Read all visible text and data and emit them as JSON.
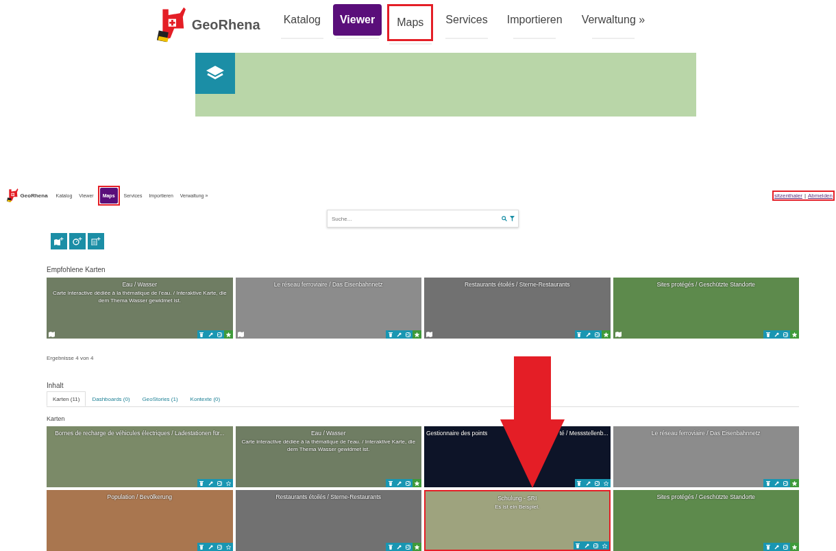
{
  "zoom_view": {
    "brand": "GeoRhena",
    "nav": [
      {
        "label": "Katalog",
        "selected": false,
        "highlighted": false
      },
      {
        "label": "Viewer",
        "selected": true,
        "highlighted": false
      },
      {
        "label": "Maps",
        "selected": false,
        "highlighted": true
      },
      {
        "label": "Services",
        "selected": false,
        "highlighted": false
      },
      {
        "label": "Importieren",
        "selected": false,
        "highlighted": false
      },
      {
        "label": "Verwaltung »",
        "selected": false,
        "highlighted": false
      }
    ]
  },
  "header": {
    "brand": "GeoRhena",
    "nav": [
      {
        "label": "Katalog",
        "selected": false,
        "highlighted": false
      },
      {
        "label": "Viewer",
        "selected": false,
        "highlighted": false
      },
      {
        "label": "Maps",
        "selected": true,
        "highlighted": true
      },
      {
        "label": "Services",
        "selected": false,
        "highlighted": false
      },
      {
        "label": "Importieren",
        "selected": false,
        "highlighted": false
      },
      {
        "label": "Verwaltung »",
        "selected": false,
        "highlighted": false
      }
    ],
    "user_links": {
      "user": "sitzenthaler",
      "separator": "|",
      "logout": "Abmelden",
      "highlighted": true
    }
  },
  "search": {
    "placeholder": "Suche..."
  },
  "featured_section": {
    "title": "Empfohlene Karten",
    "result_count": "Ergebnisse 4 von 4",
    "cards": [
      {
        "title": "Eau / Wasser",
        "description": "Carte interactive dédiée à la thématique de l'eau. / Interaktive Karte, die dem Thema Wasser gewidmet ist.",
        "color": "#6f7d63",
        "featured": true,
        "highlighted": false
      },
      {
        "title": "Le réseau ferroviaire / Das Eisenbahnnetz",
        "color": "#8c8c8c",
        "featured": true,
        "highlighted": false
      },
      {
        "title": "Restaurants étoilés / Sterne-Restaurants",
        "color": "#717171",
        "featured": true,
        "highlighted": false
      },
      {
        "title": "Sites protégés / Geschützte Standorte",
        "color": "#5d8a4c",
        "featured": true,
        "highlighted": false
      }
    ]
  },
  "content_section": {
    "title": "Inhalt",
    "tabs": [
      {
        "label": "Karten (11)",
        "selected": true
      },
      {
        "label": "Dashboards (0)",
        "selected": false
      },
      {
        "label": "GeoStories (1)",
        "selected": false
      },
      {
        "label": "Kontexte (0)",
        "selected": false
      }
    ],
    "subtitle": "Karten",
    "cards": [
      {
        "title": "Bornes de recharge de véhicules électriques / Ladestationen für...",
        "color": "#7b8a68",
        "featured": false,
        "highlighted": false
      },
      {
        "title": "Eau / Wasser",
        "description": "Carte interactive dédiée à la thématique de l'eau. / Interaktive Karte, die dem Thema Wasser gewidmet ist.",
        "color": "#6f7d63",
        "featured": true,
        "highlighted": false
      },
      {
        "title": "Gestionnaire des points",
        "title_tail": "té / Messstellenb...",
        "color": "#0d1428",
        "featured": false,
        "highlighted": false
      },
      {
        "title": "Le réseau ferroviaire / Das Eisenbahnnetz",
        "color": "#8c8c8c",
        "featured": true,
        "highlighted": false
      },
      {
        "title": "Population / Bevölkerung",
        "color": "#a9764f",
        "featured": false,
        "highlighted": false
      },
      {
        "title": "Restaurants étoilés / Sterne-Restaurants",
        "color": "#717171",
        "featured": true,
        "highlighted": false
      },
      {
        "title": "Schulung - SRI",
        "description": "Es ist ein Beispiel.",
        "color": "#9ea37e",
        "featured": false,
        "highlighted": true
      },
      {
        "title": "Sites protégés / Geschützte Standorte",
        "color": "#5d8a4c",
        "featured": true,
        "highlighted": false
      }
    ]
  }
}
